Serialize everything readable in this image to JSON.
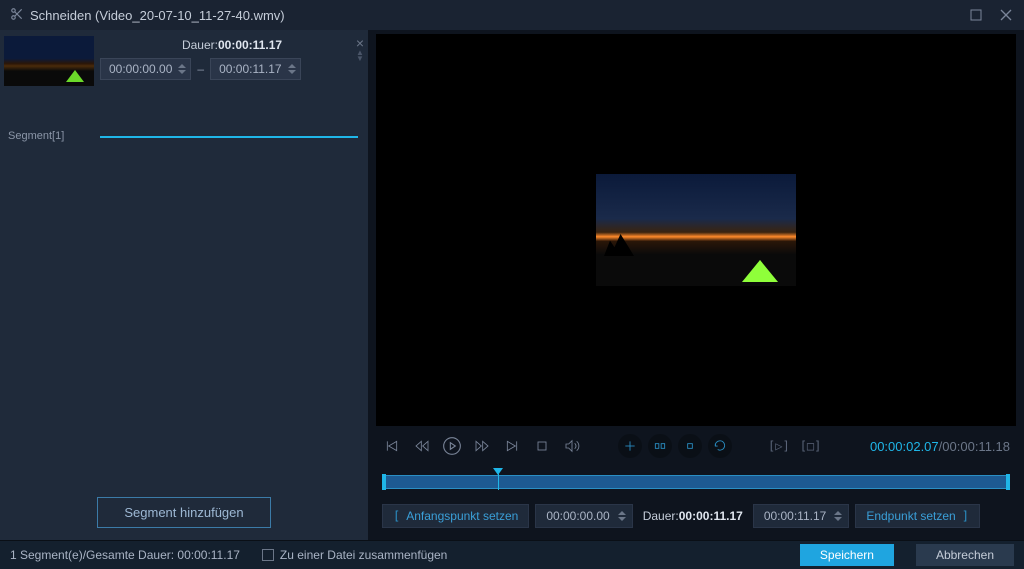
{
  "window": {
    "title": "Schneiden (Video_20-07-10_11-27-40.wmv)"
  },
  "segments": {
    "label": "Segment[1]",
    "duration_label": "Dauer:",
    "duration_value": "00:00:11.17",
    "start": "00:00:00.00",
    "end": "00:00:11.17"
  },
  "add_segment": "Segment hinzufügen",
  "playback": {
    "current": "00:00:02.07",
    "total": "00:00:11.18",
    "progress_pct": 18.5
  },
  "markers": {
    "start_label": "Anfangspunkt setzen",
    "start_time": "00:00:00.00",
    "duration_label": "Dauer:",
    "duration_value": "00:00:11.17",
    "end_time": "00:00:11.17",
    "end_label": "Endpunkt setzen"
  },
  "footer": {
    "status": "1 Segment(e)/Gesamte Dauer: 00:00:11.17",
    "merge": "Zu einer Datei zusammenfügen",
    "save": "Speichern",
    "cancel": "Abbrechen"
  }
}
